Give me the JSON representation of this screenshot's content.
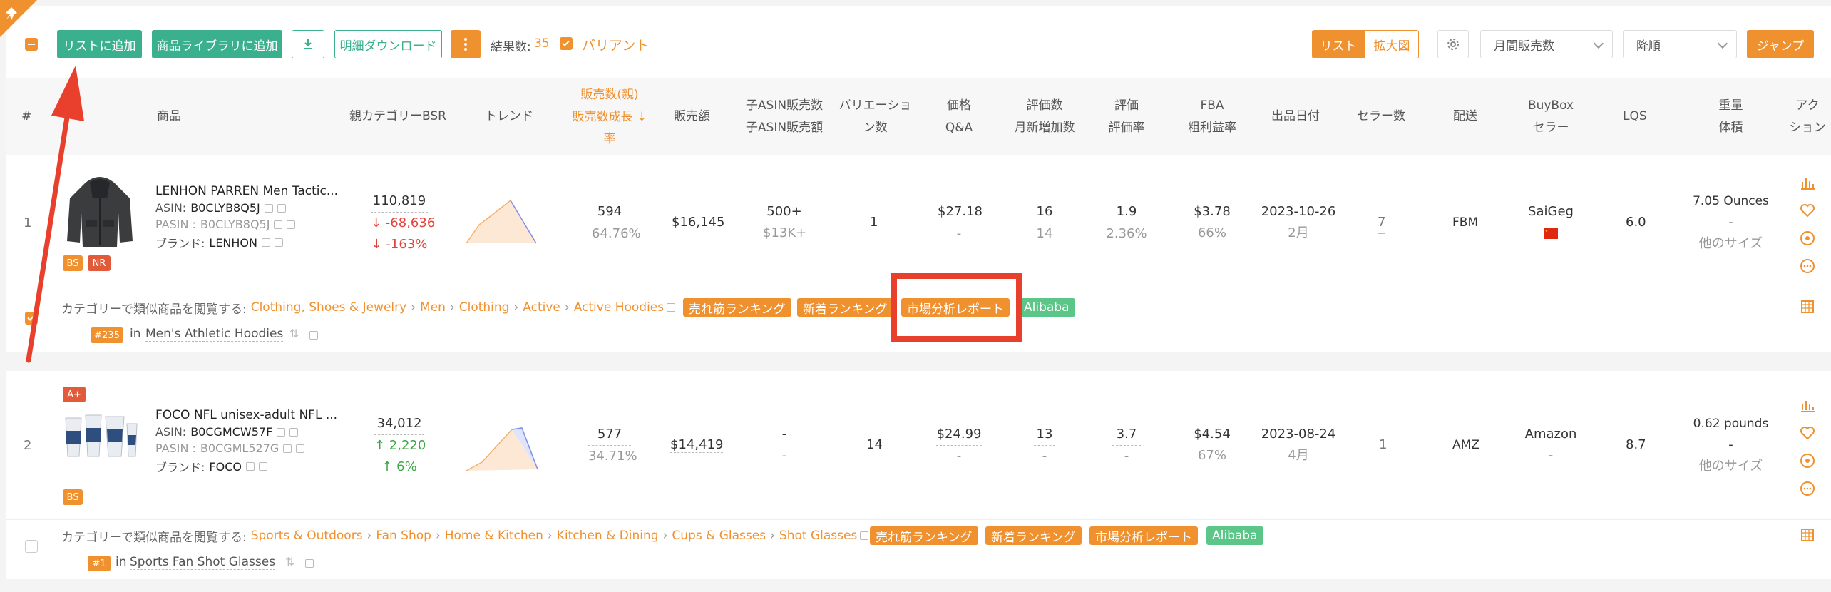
{
  "toolbar": {
    "add_list": "リストに追加",
    "add_library": "商品ライブラリに追加",
    "detail_download": "明細ダウンロード",
    "result_label": "結果数:",
    "result_count": "35",
    "variant_label": "バリアント",
    "view_list": "リスト",
    "view_large": "拡大図",
    "sort_field": "月間販売数",
    "sort_order": "降順",
    "jump": "ジャンプ"
  },
  "columns": {
    "num": "#",
    "product": "商品",
    "bsr": "親カテゴリーBSR",
    "trend": "トレンド",
    "sales_1": "販売数(親)",
    "sales_2": "販売数成長",
    "sales_3": "率",
    "revenue": "販売額",
    "child_1": "子ASIN販売数",
    "child_2": "子ASIN販売額",
    "var_1": "バリエーショ",
    "var_2": "ン数",
    "price_1": "価格",
    "price_2": "Q&A",
    "rev_1": "評価数",
    "rev_2": "月新増加数",
    "rate_1": "評価",
    "rate_2": "評価率",
    "fba_1": "FBA",
    "fba_2": "粗利益率",
    "date": "出品日付",
    "sellers": "セラー数",
    "ship": "配送",
    "bb_1": "BuyBox",
    "bb_2": "セラー",
    "lqs": "LQS",
    "wt_1": "重量",
    "wt_2": "体積",
    "act_1": "アク",
    "act_2": "ション"
  },
  "rows": [
    {
      "num": "1",
      "title": "LENHON PARREN Men Tactic...",
      "asin_label": "ASIN:",
      "asin": "B0CLYB8Q5J",
      "pasin_label": "PASIN :",
      "pasin": "B0CLYB8Q5J",
      "brand_label": "ブランド:",
      "brand": "LENHON",
      "badges": [
        "BS",
        "NR"
      ],
      "bsr": "110,819",
      "bsr_change": "↓ -68,636",
      "bsr_pct": "↓ -163%",
      "sales": "594",
      "sales_growth": "64.76%",
      "revenue": "$16,145",
      "child_sales": "500+",
      "child_revenue": "$13K+",
      "variations": "1",
      "price": "$27.18",
      "qa": "-",
      "reviews": "16",
      "reviews_new": "14",
      "rating": "1.9",
      "rating_rate": "2.36%",
      "fba": "$3.78",
      "margin": "66%",
      "date": "2023-10-26",
      "date_sub": "2月",
      "sellers": "7",
      "ship": "FBM",
      "buybox": "SaiGeg",
      "lqs": "6.0",
      "weight": "7.05 Ounces",
      "volume": "-",
      "size_link": "他のサイズ",
      "cat_label": "カテゴリーで類似商品を閲覧する:",
      "cat_path": [
        "Clothing, Shoes & Jewelry",
        "Men",
        "Clothing",
        "Active",
        "Active Hoodies"
      ],
      "tags": [
        "売れ筋ランキング",
        "新着ランキング",
        "市場分析レポート",
        "Alibaba"
      ],
      "rank": "#235",
      "rank_in": "in",
      "rank_cat": "Men's Athletic Hoodies"
    },
    {
      "num": "2",
      "title": "FOCO NFL unisex-adult NFL ...",
      "asin_label": "ASIN:",
      "asin": "B0CGMCW57F",
      "pasin_label": "PASIN :",
      "pasin": "B0CGML527G",
      "brand_label": "ブランド:",
      "brand": "FOCO",
      "badges": [
        "A+",
        "BS"
      ],
      "bsr": "34,012",
      "bsr_change": "↑ 2,220",
      "bsr_pct": "↑ 6%",
      "sales": "577",
      "sales_growth": "34.71%",
      "revenue": "$14,419",
      "child_sales": "-",
      "child_revenue": "-",
      "variations": "14",
      "price": "$24.99",
      "qa": "-",
      "reviews": "13",
      "reviews_new": "-",
      "rating": "3.7",
      "rating_rate": "-",
      "fba": "$4.54",
      "margin": "67%",
      "date": "2023-08-24",
      "date_sub": "4月",
      "sellers": "1",
      "ship": "AMZ",
      "buybox": "Amazon",
      "buybox_sub": "-",
      "lqs": "8.7",
      "weight": "0.62 pounds",
      "volume": "-",
      "size_link": "他のサイズ",
      "cat_label": "カテゴリーで類似商品を閲覧する:",
      "cat_path": [
        "Sports & Outdoors",
        "Fan Shop",
        "Home & Kitchen",
        "Kitchen & Dining",
        "Cups & Glasses",
        "Shot Glasses"
      ],
      "tags": [
        "売れ筋ランキング",
        "新着ランキング",
        "市場分析レポート",
        "Alibaba"
      ],
      "rank": "#1",
      "rank_in": "in",
      "rank_cat": "Sports Fan Shot Glasses"
    }
  ],
  "colors": {
    "accent": "#f0912f",
    "green": "#3bb08f",
    "annotation": "#e8402c"
  }
}
